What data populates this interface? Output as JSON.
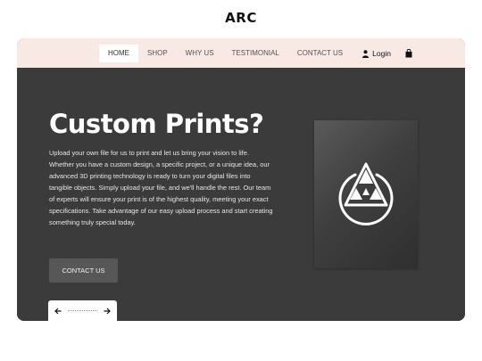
{
  "brand": "ARC",
  "nav": {
    "items": [
      {
        "label": "HOME",
        "active": true
      },
      {
        "label": "SHOP"
      },
      {
        "label": "WHY US"
      },
      {
        "label": "TESTIMONIAL"
      },
      {
        "label": "CONTACT US"
      }
    ],
    "login": "Login",
    "icons": {
      "login": "user-icon",
      "cart": "shopping-bag-icon"
    }
  },
  "hero": {
    "title": "Custom Prints?",
    "description": "Upload your own file for us to print and let us bring your vision to life. Whether you have a custom design, a specific project, or a unique idea, our advanced 3D printing technology is ready to turn your digital files into tangible objects. Simply upload your file, and we'll handle the rest. Our team of experts will ensure your print is of the highest quality, meeting your exact specifications. Take advantage of our easy upload process and start creating something truly special today.",
    "cta": "CONTACT US"
  },
  "slider": {
    "prev_icon": "arrow-left-icon",
    "next_icon": "arrow-right-icon"
  },
  "product_image": {
    "icon": "triangle-logo-icon"
  },
  "colors": {
    "navbar_bg": "#f8e9e5",
    "hero_bg": "#3b3b3b",
    "button_bg": "#575757",
    "text_light": "#ffffff"
  }
}
